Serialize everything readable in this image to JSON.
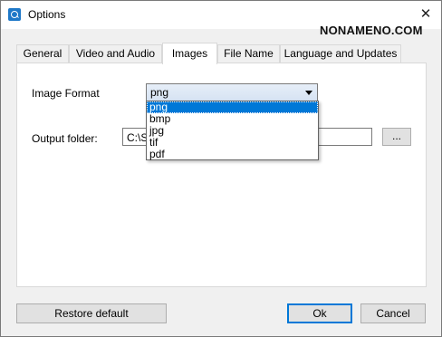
{
  "window": {
    "title": "Options",
    "close_glyph": "✕"
  },
  "watermark": "NONAMENO.COM",
  "tabs": [
    {
      "label": "General"
    },
    {
      "label": "Video and Audio"
    },
    {
      "label": "Images",
      "active": true
    },
    {
      "label": "File Name"
    },
    {
      "label": "Language and Updates"
    }
  ],
  "images": {
    "format_label": "Image Format",
    "format_selected": "png",
    "format_options": [
      "png",
      "bmp",
      "jpg",
      "tif",
      "pdf"
    ],
    "output_label": "Output folder:",
    "output_value": "C:\\S",
    "browse_label": "..."
  },
  "buttons": {
    "restore": "Restore default",
    "ok": "Ok",
    "cancel": "Cancel"
  },
  "colors": {
    "accent": "#0078d7"
  }
}
